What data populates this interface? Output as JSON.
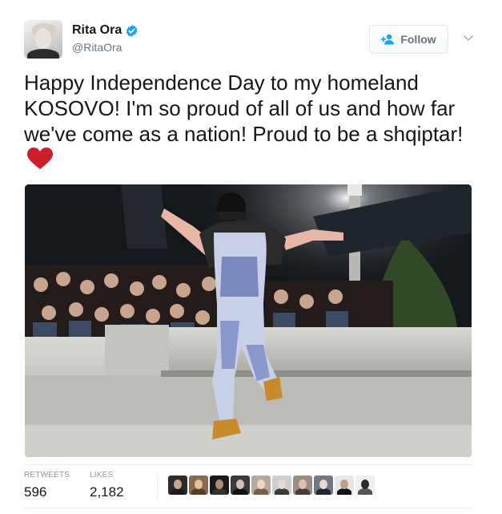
{
  "user": {
    "display_name": "Rita Ora",
    "handle": "@RitaOra",
    "verified_icon": "verified-badge-icon"
  },
  "follow_button": {
    "label": "Follow",
    "icon": "add-person-icon"
  },
  "menu_icon": "chevron-down-icon",
  "tweet": {
    "text": "Happy Independence Day to my homeland KOSOVO! I'm so proud of all of us and how far we've come as a nation! Proud to be a shqiptar!",
    "emoji": "red-heart-icon"
  },
  "media": {
    "type": "photo"
  },
  "stats": {
    "retweets_label": "RETWEETS",
    "retweets_count": "596",
    "likes_label": "LIKES",
    "likes_count": "2,182"
  },
  "likers": [
    {
      "bg": "#2e2a28",
      "face": "#caa58a",
      "body": "#1b1b1b"
    },
    {
      "bg": "#8a6a4e",
      "face": "#e3c2a3",
      "body": "#5a3b26"
    },
    {
      "bg": "#1a1a1a",
      "face": "#b38c70",
      "body": "#333333"
    },
    {
      "bg": "#3b3b3b",
      "face": "#d8c0b0",
      "body": "#111111"
    },
    {
      "bg": "#b7a9a0",
      "face": "#f1d6c4",
      "body": "#7a5c4a"
    },
    {
      "bg": "#cfcfcf",
      "face": "#e8dcd2",
      "body": "#3a3a3a"
    },
    {
      "bg": "#9b8c86",
      "face": "#e0c3ae",
      "body": "#4a3a34"
    },
    {
      "bg": "#6d7a86",
      "face": "#ead7c9",
      "body": "#222831"
    },
    {
      "bg": "#e7e7e7",
      "face": "#c59f86",
      "body": "#111111"
    },
    {
      "bg": "#f0f0f0",
      "face": "#2a2a2a",
      "body": "#555555"
    }
  ],
  "colors": {
    "text": "#14171a",
    "secondary": "#657786",
    "verified": "#1da1f2",
    "heart": "#cc1f2a",
    "divider": "#e6ecf0"
  }
}
